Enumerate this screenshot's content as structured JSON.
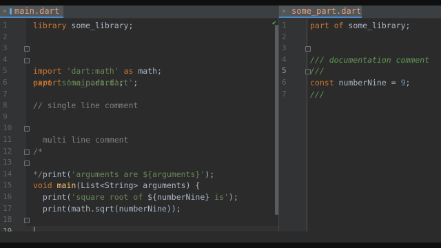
{
  "left_editor": {
    "tab_label": "main.dart",
    "tab_close": "×",
    "status_check": "✔",
    "line_numbers": [
      "1",
      "2",
      "3",
      "4",
      "5",
      "6",
      "7",
      "8",
      "9",
      "10",
      "11",
      "12",
      "13",
      "14",
      "15",
      "16",
      "17",
      "18",
      "19"
    ],
    "code": {
      "l1_kw": "library",
      "l1_rest": " some_library;",
      "l3_kw": "import",
      "l3_str": "'dart:math'",
      "l3_as": " as",
      "l3_rest": " math;",
      "l4_kw": "export",
      "l4_str": " 'main.dart'",
      "l4_rest": ";",
      "l6_kw": "part",
      "l6_str": " 'some_part.dart'",
      "l6_rest": ";",
      "l8_cm": "// single line comment",
      "l10_cm": "/*",
      "l11_cm": "  multi line comment",
      "l12_cm": "*/",
      "l13_kw": "void",
      "l13_fn": " main",
      "l13_rest": "(List<String> arguments) {",
      "l14_a": "  print(",
      "l14_str": "'arguments are ${arguments}'",
      "l14_b": ");",
      "l16_a": "  print(",
      "l16_str1": "'square root of ",
      "l16_mid": "${numberNine}",
      "l16_str2": " is'",
      "l16_b": ");",
      "l17": "  print(math.sqrt(numberNine));",
      "l18": "}"
    }
  },
  "right_editor": {
    "tab_label": "some_part.dart",
    "tab_close": "×",
    "line_numbers": [
      "1",
      "2",
      "3",
      "4",
      "5",
      "6",
      "7"
    ],
    "code": {
      "l1_kw": "part of",
      "l1_rest": " some_library;",
      "l3_doc": "///",
      "l4_doc": "/// documentation comment",
      "l5_doc": "///",
      "l6_kw": "const",
      "l6_rest": " numberNine = ",
      "l6_num": "9",
      "l6_end": ";"
    }
  },
  "colors": {
    "background": "#2b2b2b",
    "keyword": "#cc7832",
    "string": "#6a8759",
    "comment": "#808080",
    "doc_comment": "#629755",
    "function": "#ffc66d",
    "number": "#6897bb"
  }
}
